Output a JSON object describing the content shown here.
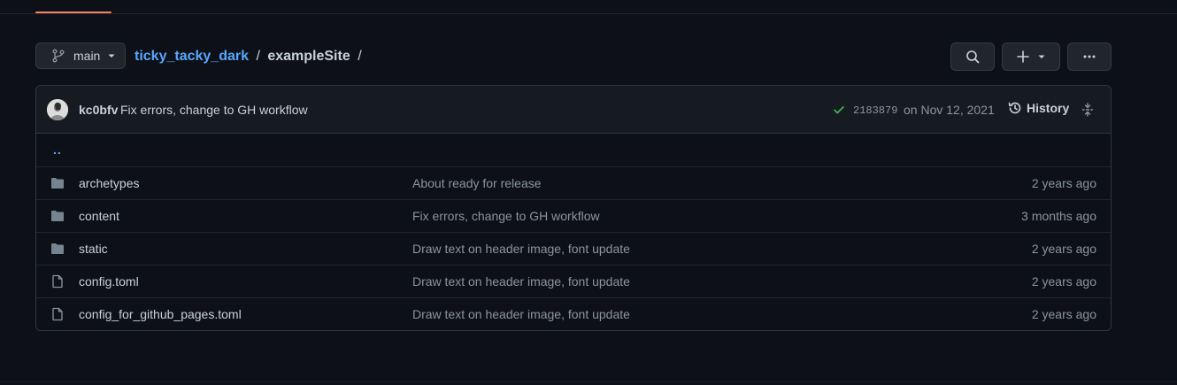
{
  "branch": {
    "name": "main",
    "icon": "git-branch-icon"
  },
  "breadcrumb": {
    "repo": "ticky_tacky_dark",
    "separator": "/",
    "dir": "exampleSite",
    "trailing": "/"
  },
  "toolbar": {
    "search_icon": "search-icon",
    "add_icon": "plus-icon",
    "more_icon": "kebab-horizontal-icon"
  },
  "commit": {
    "author": "kc0bfv",
    "message": "Fix errors, change to GH workflow",
    "sha": "2183879",
    "date": "on Nov 12, 2021",
    "history_label": "History",
    "status": "success"
  },
  "parent_link": "..",
  "files": [
    {
      "type": "folder",
      "name": "archetypes",
      "message": "About ready for release",
      "age": "2 years ago"
    },
    {
      "type": "folder",
      "name": "content",
      "message": "Fix errors, change to GH workflow",
      "age": "3 months ago"
    },
    {
      "type": "folder",
      "name": "static",
      "message": "Draw text on header image, font update",
      "age": "2 years ago"
    },
    {
      "type": "file",
      "name": "config.toml",
      "message": "Draw text on header image, font update",
      "age": "2 years ago"
    },
    {
      "type": "file",
      "name": "config_for_github_pages.toml",
      "message": "Draw text on header image, font update",
      "age": "2 years ago"
    }
  ],
  "colors": {
    "background": "#0d1117",
    "accent_link": "#58a6ff",
    "tab_underline": "#f78166",
    "success": "#3fb950"
  }
}
